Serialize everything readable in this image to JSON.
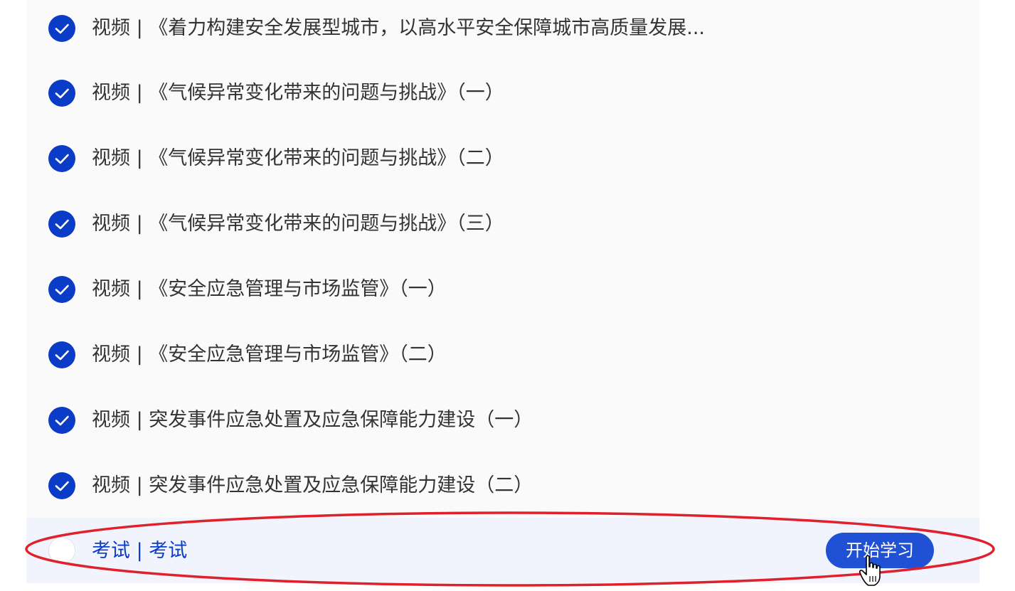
{
  "items": [
    {
      "type": "视频",
      "title": "《着力构建安全发展型城市，以高水平安全保障城市高质量发展...",
      "completed": true
    },
    {
      "type": "视频",
      "title": "《气候异常变化带来的问题与挑战》（一）",
      "completed": true
    },
    {
      "type": "视频",
      "title": "《气候异常变化带来的问题与挑战》（二）",
      "completed": true
    },
    {
      "type": "视频",
      "title": "《气候异常变化带来的问题与挑战》（三）",
      "completed": true
    },
    {
      "type": "视频",
      "title": "《安全应急管理与市场监管》（一）",
      "completed": true
    },
    {
      "type": "视频",
      "title": "《安全应急管理与市场监管》（二）",
      "completed": true
    },
    {
      "type": "视频",
      "title": "突发事件应急处置及应急保障能力建设（一）",
      "completed": true
    },
    {
      "type": "视频",
      "title": "突发事件应急处置及应急保障能力建设（二）",
      "completed": true
    }
  ],
  "exam": {
    "type": "考试",
    "title": "考试",
    "completed": false,
    "start_label": "开始学习"
  },
  "colors": {
    "accent": "#0b3cc8",
    "button": "#2050d4",
    "highlight_ring": "#e0202a",
    "active_row_bg": "#f1f4fc"
  },
  "icons": {
    "completed": "check-circle-icon",
    "pending": "empty-circle-icon",
    "cursor": "hand-pointer-icon"
  }
}
